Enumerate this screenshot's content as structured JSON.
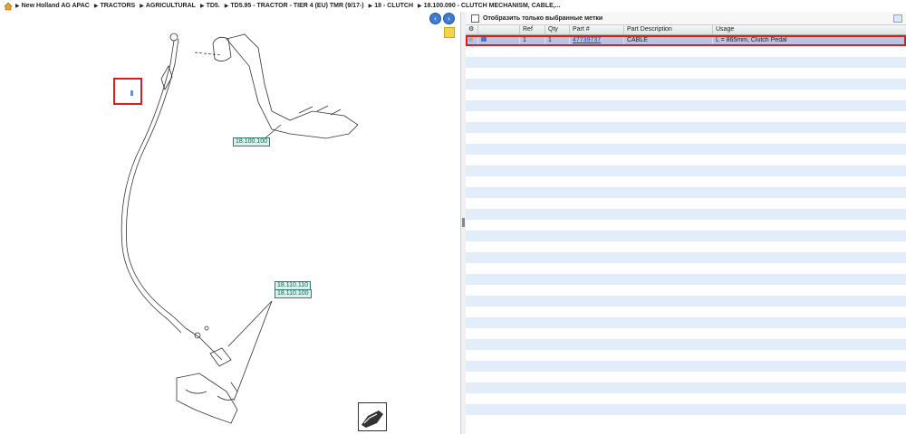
{
  "breadcrumb": {
    "items": [
      "New Holland AG APAC",
      "TRACTORS",
      "AGRICULTURAL",
      "TD5.",
      "TD5.95 - TRACTOR - TIER 4 (EU) TMR (9/17-)",
      "18 - CLUTCH",
      "18.100.090 - CLUTCH MECHANISM, CABLE,..."
    ]
  },
  "diagram": {
    "callouts": [
      "18.100.100",
      "18.110.110",
      "18.110.100"
    ]
  },
  "parts_panel": {
    "filter_label": "Отобразить только выбранные метки",
    "columns": [
      "Ref",
      "Qty",
      "Part #",
      "Part Description",
      "Usage"
    ],
    "rows": [
      {
        "ref": "1",
        "qty": "1",
        "part": "47739737",
        "description": "CABLE",
        "usage": "L = 865mm, Clutch Pedal"
      }
    ]
  },
  "colors": {
    "accent": "#3d7bd1",
    "selection_outline": "#d62020",
    "row_alt": "#e3edf9"
  }
}
